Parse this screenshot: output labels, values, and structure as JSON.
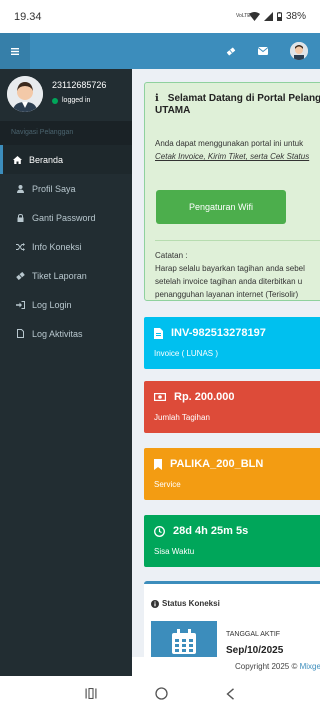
{
  "status_bar": {
    "time": "19.34",
    "network": "VoLTE",
    "battery": "38%"
  },
  "user": {
    "name": "23112685726",
    "status": "logged in"
  },
  "sidebar": {
    "header": "Navigasi Pelanggan",
    "items": [
      {
        "label": "Beranda",
        "icon": "home-icon",
        "active": true
      },
      {
        "label": "Profil Saya",
        "icon": "user-icon"
      },
      {
        "label": "Ganti Password",
        "icon": "lock-icon"
      },
      {
        "label": "Info Koneksi",
        "icon": "shuffle-icon"
      },
      {
        "label": "Tiket Laporan",
        "icon": "ticket-icon"
      },
      {
        "label": "Log Login",
        "icon": "sign-in-icon"
      },
      {
        "label": "Log Aktivitas",
        "icon": "file-icon"
      }
    ]
  },
  "welcome": {
    "title_line1": "Selamat Datang di Portal Pelang",
    "title_line2": "UTAMA",
    "desc_line1": "Anda dapat menggunakan portal ini untuk",
    "desc_line2": "Cetak Invoice, Kirim Tiket, serta Cek Status",
    "button_label": "Pengaturan Wifi",
    "note_heading": "Catatan :",
    "note_line1": "Harap selalu bayarkan tagihan anda sebel",
    "note_line2": "setelah invoice tagihan anda diterbitkan u",
    "note_line3": "penangguhan layanan internet (Terisolir)"
  },
  "cards": {
    "invoice": {
      "title": "INV-982513278197",
      "subtitle": "Invoice ( LUNAS )"
    },
    "amount": {
      "title": "Rp. 200.000",
      "subtitle": "Jumlah Tagihan"
    },
    "service": {
      "title": "PALIKA_200_BLN",
      "subtitle": "Service"
    },
    "time_left": {
      "title": "28d 4h 25m 5s",
      "subtitle": "Sisa Waktu"
    }
  },
  "connection": {
    "title": "Status Koneksi",
    "active_label": "TANGGAL AKTIF",
    "active_date": "Sep/10/2025"
  },
  "footer": {
    "text": "Copyright 2025 ©",
    "link": "Mixge"
  },
  "colors": {
    "navbar": "#3c8dbc",
    "sidebar": "#222d32",
    "success": "#00a65a",
    "info": "#00c0ef",
    "danger": "#dd4b39",
    "warning": "#f39c12"
  }
}
